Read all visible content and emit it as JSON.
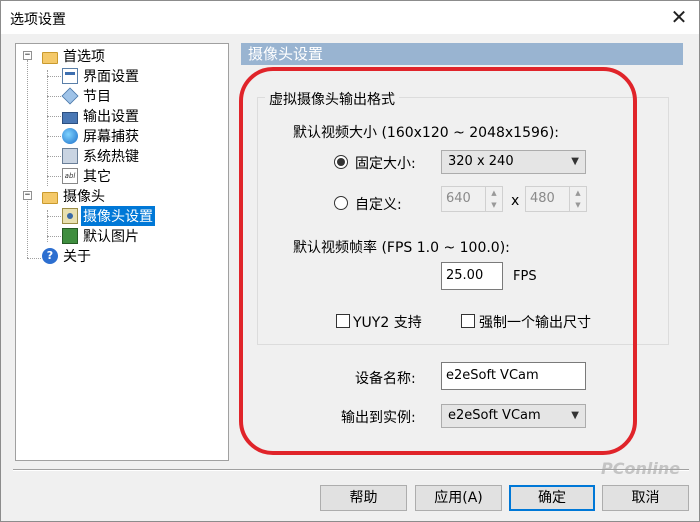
{
  "window": {
    "title": "选项设置"
  },
  "tree": {
    "items": [
      {
        "label": "首选项"
      },
      {
        "label": "界面设置"
      },
      {
        "label": "节目"
      },
      {
        "label": "输出设置"
      },
      {
        "label": "屏幕捕获"
      },
      {
        "label": "系统热键"
      },
      {
        "label": "其它"
      },
      {
        "label": "摄像头"
      },
      {
        "label": "摄像头设置"
      },
      {
        "label": "默认图片"
      },
      {
        "label": "关于"
      }
    ],
    "expander_symbol": "−"
  },
  "pane": {
    "header": "摄像头设置",
    "group_title": "虚拟摄像头输出格式",
    "video_size_label": "默认视频大小 (160x120 ~ 2048x1596):",
    "fixed_size_label": "固定大小:",
    "fixed_size_value": "320 x 240",
    "custom_label": "自定义:",
    "custom_width": "640",
    "custom_x": "x",
    "custom_height": "480",
    "framerate_label": "默认视频帧率 (FPS 1.0 ~ 100.0):",
    "framerate_value": "25.00",
    "fps_unit": "FPS",
    "yuy2_label": "YUY2 支持",
    "force_size_label": "强制一个输出尺寸",
    "device_name_label": "设备名称:",
    "device_name_value": "e2eSoft VCam",
    "output_instance_label": "输出到实例:",
    "output_instance_value": "e2eSoft VCam"
  },
  "buttons": {
    "help": "帮助",
    "apply": "应用(A)",
    "ok": "确定",
    "cancel": "取消"
  },
  "watermark": "PConline",
  "colors": {
    "selection": "#0078d7",
    "header": "#99b4d1",
    "highlight": "#e0242a"
  }
}
